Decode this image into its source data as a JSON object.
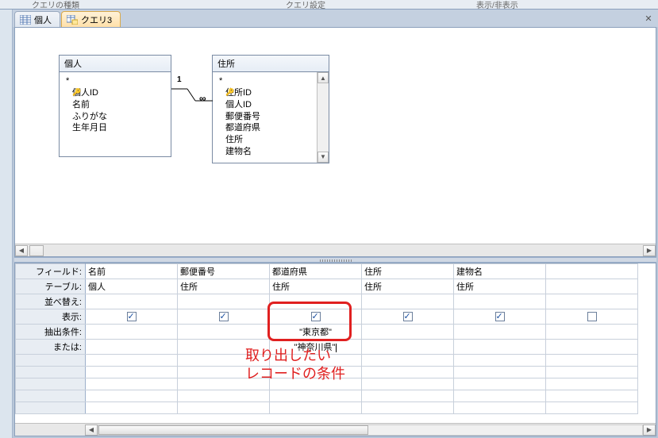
{
  "ribbon": {
    "group1": "クエリの種類",
    "group2": "クエリ設定",
    "group3": "表示/非表示"
  },
  "tabs": [
    {
      "label": "個人",
      "active": false
    },
    {
      "label": "クエリ3",
      "active": true
    }
  ],
  "tables": {
    "kojin": {
      "title": "個人",
      "fields": [
        "*",
        "個人ID",
        "名前",
        "ふりがな",
        "生年月日"
      ],
      "pk_index": 1
    },
    "jusho": {
      "title": "住所",
      "fields": [
        "*",
        "住所ID",
        "個人ID",
        "郵便番号",
        "都道府県",
        "住所",
        "建物名"
      ],
      "pk_index": 1
    }
  },
  "join": {
    "left_label": "1",
    "right_label": "∞"
  },
  "grid": {
    "row_labels": {
      "field": "フィールド:",
      "table": "テーブル:",
      "sort": "並べ替え:",
      "show": "表示:",
      "criteria": "抽出条件:",
      "or": "または:"
    },
    "columns": [
      {
        "field": "名前",
        "table": "個人",
        "show": true,
        "criteria": "",
        "or": ""
      },
      {
        "field": "郵便番号",
        "table": "住所",
        "show": true,
        "criteria": "",
        "or": ""
      },
      {
        "field": "都道府県",
        "table": "住所",
        "show": true,
        "criteria": "\"東京都\"",
        "or": "\"神奈川県\""
      },
      {
        "field": "住所",
        "table": "住所",
        "show": true,
        "criteria": "",
        "or": ""
      },
      {
        "field": "建物名",
        "table": "住所",
        "show": true,
        "criteria": "",
        "or": ""
      },
      {
        "field": "",
        "table": "",
        "show": false,
        "criteria": "",
        "or": ""
      }
    ]
  },
  "annotation": {
    "line1": "取り出したい",
    "line2": "レコードの条件"
  }
}
